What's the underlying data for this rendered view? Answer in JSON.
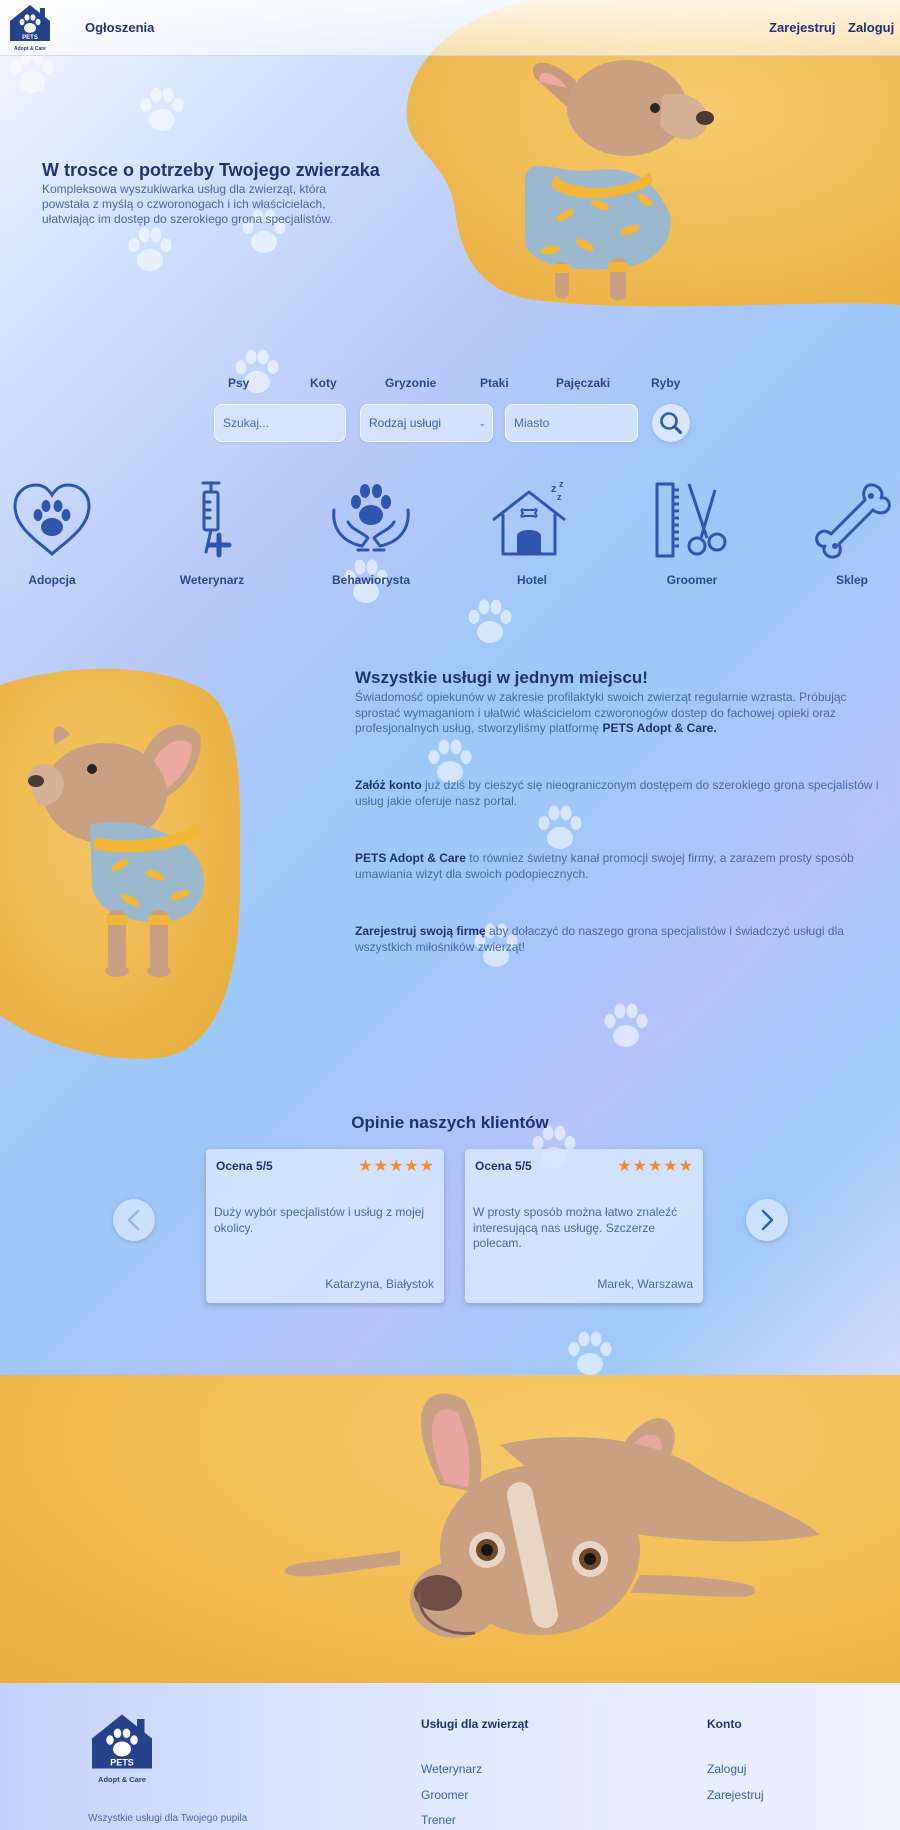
{
  "header": {
    "logo_text": "PETS",
    "logo_subtext": "Adopt & Care",
    "nav_announcements": "Ogłoszenia",
    "register": "Zarejestruj",
    "login": "Zaloguj"
  },
  "hero": {
    "title": "W trosce o potrzeby Twojego zwierzaka",
    "text": "Kompleksowa wyszukiwarka usług dla zwierząt, która powstała z myślą o czworonogach i ich właścicielach, ułatwiając im dostęp do szerokiego grona specjalistów."
  },
  "search": {
    "categories": [
      "Psy",
      "Koty",
      "Gryzonie",
      "Ptaki",
      "Pajęczaki",
      "Ryby"
    ],
    "query_placeholder": "Szukaj...",
    "service_type": "Rodzaj usługi",
    "city_placeholder": "Miasto"
  },
  "services": [
    {
      "label": "Adopcja",
      "icon": "heart-paw-icon"
    },
    {
      "label": "Weterynarz",
      "icon": "syringe-icon"
    },
    {
      "label": "Behawiorysta",
      "icon": "hands-paw-icon"
    },
    {
      "label": "Hotel",
      "icon": "dog-house-icon"
    },
    {
      "label": "Groomer",
      "icon": "comb-scissors-icon"
    },
    {
      "label": "Sklep",
      "icon": "bone-icon"
    }
  ],
  "about": {
    "title": "Wszystkie usługi w jednym miejscu!",
    "p1_text": "Świadomość opiekunów w zakresie profilaktyki swoich zwierząt regularnie wzrasta. Próbując sprostać wymaganiom i ułatwić właścicielom czworonogów dostep do fachowej opieki oraz profesjonalnych usług, stworzyliśmy platformę ",
    "p1_bold": "PETS Adopt & Care.",
    "p2_bold": "Załóż konto",
    "p2_text": " już dziś by cieszyć się nieograniczonym dostępem do szerokiego grona specjalistów i usług jakie oferuje nasz portal.",
    "p3_bold": "PETS Adopt & Care",
    "p3_text": " to równiez świetny kanał promocji swojej firmy, a zarazem prosty sposób umawiania wizyt dla swoich podopiecznych.",
    "p4_bold": "Zarejestruj swoją firmę",
    "p4_text": " aby dołaczyć do naszego grona specjalistów i świadczyć usługi dla wszystkich miłośników zwierząt!"
  },
  "reviews": {
    "title": "Opinie naszych klientów",
    "items": [
      {
        "rating": "Ocena 5/5",
        "stars": "★★★★★",
        "text": "Duży wybór specjalistów i usług z mojej okolicy.",
        "author": "Katarzyna, Białystok"
      },
      {
        "rating": "Ocena 5/5",
        "stars": "★★★★★",
        "text": "W prosty sposób można łatwo znaleźć interesującą nas usługę. Szczerze polecam.",
        "author": "Marek, Warszawa"
      }
    ]
  },
  "footer": {
    "logo_text": "PETS",
    "logo_subtext": "Adopt & Care",
    "tagline": "Wszystkie usługi dla Twojego pupila",
    "services_heading": "Usługi dla zwierząt",
    "services_links": [
      "Weterynarz",
      "Groomer",
      "Trener"
    ],
    "account_heading": "Konto",
    "account_links": [
      "Zaloguj",
      "Zarejestruj"
    ]
  },
  "colors": {
    "primary": "#2b4a8a",
    "heading": "#1f3470",
    "accent_yellow": "#f2be56",
    "star": "#f08c2e"
  }
}
